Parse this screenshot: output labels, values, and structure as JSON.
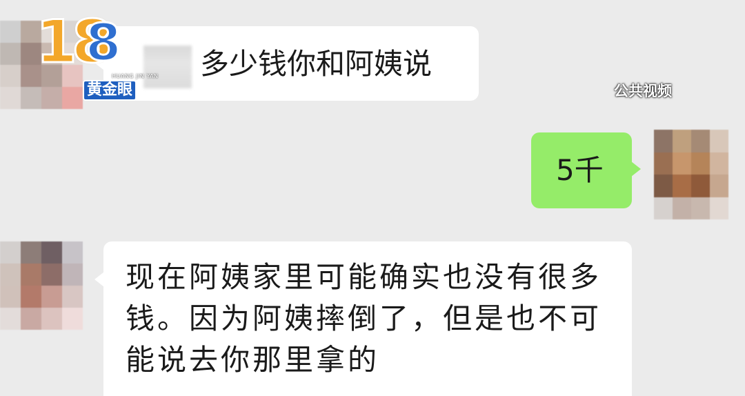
{
  "colors": {
    "background": "#ebebeb",
    "incoming_bubble": "#ffffff",
    "outgoing_bubble": "#95ec69",
    "text": "#1a1a1a",
    "logo_orange": "#f3a72a",
    "logo_blue": "#2f6fd0"
  },
  "watermark": {
    "logo_number": "18",
    "logo_number_2": "8",
    "logo_pinyin": "HUANG JIN YAN",
    "logo_name": "黄金眼",
    "source_tag": "公共视频"
  },
  "messages": [
    {
      "direction": "incoming",
      "text": "多少钱你和阿姨说"
    },
    {
      "direction": "outgoing",
      "text": "5千"
    },
    {
      "direction": "incoming",
      "text": "现在阿姨家里可能确实也没有很多钱。因为阿姨摔倒了，但是也不可能说去你那里拿的"
    }
  ],
  "avatars": {
    "left_1": [
      "#cfcfcf",
      "#b9a99f",
      "#e3ddd9",
      "#d9d5d3",
      "#bfb8b3",
      "#9d8780",
      "#c9b9b0",
      "#e4dcd8",
      "#d7cfca",
      "#a9918a",
      "#b3a098",
      "#e7c4c1",
      "#e0d9d6",
      "#c5bcb8",
      "#c5aea9",
      "#e9a7a3"
    ],
    "right": [
      "#8d7466",
      "#bfa07e",
      "#a58a75",
      "#d8c7b9",
      "#9a6f52",
      "#c7966c",
      "#b58459",
      "#d1b59f",
      "#7d5a45",
      "#a86d46",
      "#8f5a3a",
      "#c6a78f",
      "#d6d1ce",
      "#c3b1a8",
      "#c8b8ae",
      "#e2d8d2"
    ],
    "left_2": [
      "#d3cfcd",
      "#8d7d78",
      "#6f5f63",
      "#c7c3c8",
      "#cfc2bb",
      "#a97a68",
      "#8d6d68",
      "#c0b5b8",
      "#d0c1ba",
      "#b37a6a",
      "#c89c93",
      "#d8c6c3",
      "#e3dcda",
      "#c9a9a3",
      "#dcc3bf",
      "#efdcdb"
    ]
  }
}
